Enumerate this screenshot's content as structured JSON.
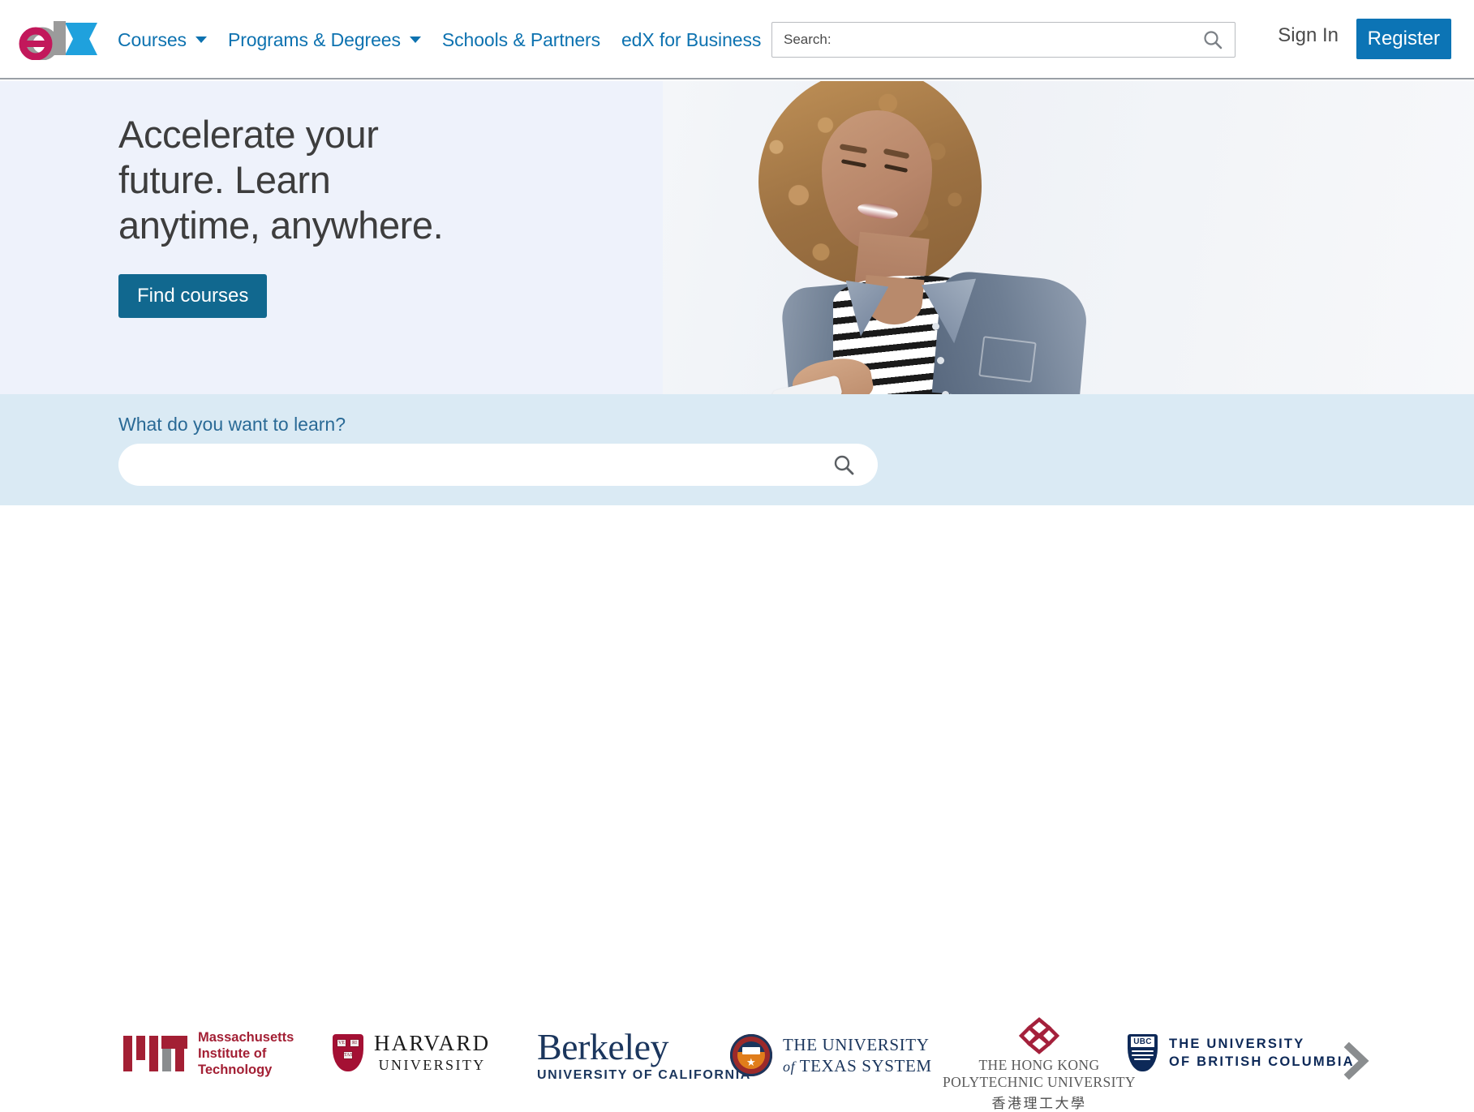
{
  "header": {
    "logo": {
      "part_e": "e",
      "part_d": "d",
      "part_x": "X",
      "alt": "edX"
    },
    "nav": [
      {
        "label": "Courses",
        "has_caret": true
      },
      {
        "label": "Programs & Degrees",
        "has_caret": true
      },
      {
        "label": "Schools & Partners",
        "has_caret": false
      },
      {
        "label": "edX for Business",
        "has_caret": false
      }
    ],
    "search": {
      "placeholder": "Search:",
      "value": "",
      "icon": "search-icon"
    },
    "sign_in_label": "Sign In",
    "register_label": "Register"
  },
  "hero": {
    "title_line1": "Accelerate your",
    "title_line2": "future. Learn",
    "title_line3": "anytime, anywhere.",
    "cta_label": "Find courses",
    "image_alt": "Smiling woman with curly hair in denim jacket using a smartphone"
  },
  "search_band": {
    "label": "What do you want to learn?",
    "placeholder": "",
    "value": "",
    "icon": "search-icon"
  },
  "partners": {
    "next_label": "›",
    "items": [
      {
        "name": "mit",
        "line1": "Massachusetts",
        "line2": "Institute of",
        "line3": "Technology"
      },
      {
        "name": "harvard",
        "line1": "HARVARD",
        "line2": "UNIVERSITY",
        "shield_b1": "VE",
        "shield_b2": "RI",
        "shield_b3": "TAS"
      },
      {
        "name": "berkeley",
        "line1": "Berkeley",
        "line2": "UNIVERSITY OF CALIFORNIA"
      },
      {
        "name": "ut-system",
        "line1": "THE UNIVERSITY",
        "line2_italic": "of",
        "line2": "TEXAS SYSTEM"
      },
      {
        "name": "hk-polyu",
        "line1": "THE HONG KONG",
        "line2": "POLYTECHNIC UNIVERSITY",
        "line3": "香港理工大學"
      },
      {
        "name": "ubc",
        "badge": "UBC",
        "line1": "THE UNIVERSITY",
        "line2": "OF BRITISH COLUMBIA"
      }
    ]
  },
  "colors": {
    "nav_link": "#0d72b0",
    "register_bg": "#0c74b5",
    "cta_bg": "#11688f",
    "hero_bg": "#eef2fb",
    "search_band_bg": "#daeaf4",
    "logo_e": "#c2185b",
    "logo_d": "#9b9b9b",
    "logo_x": "#1fa1dd",
    "mit_crimson": "#a31f34",
    "harvard_crimson": "#a41034",
    "berkeley_navy": "#1b365d",
    "ubc_navy": "#0d2958",
    "hkpu_crimson": "#a4203b"
  }
}
